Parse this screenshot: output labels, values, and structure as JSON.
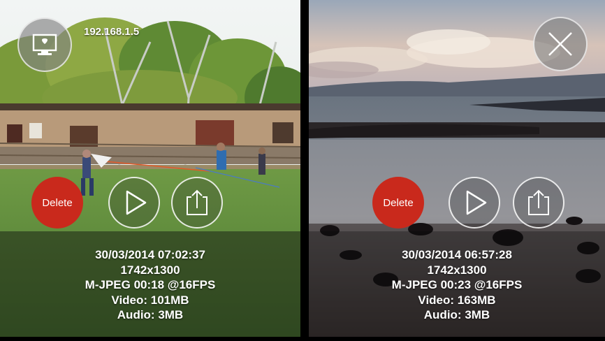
{
  "left_panel": {
    "ip_address": "192.168.1.5",
    "top_button_icon": "monitor-icon",
    "buttons": {
      "delete_label": "Delete",
      "play_icon": "play-icon",
      "share_icon": "share-icon"
    },
    "info": {
      "datetime": "30/03/2014 07:02:37",
      "resolution": "1742x1300",
      "format": "M-JPEG 00:18 @16FPS",
      "video": "Video:  101MB",
      "audio": "Audio:  3MB"
    }
  },
  "right_panel": {
    "top_button_icon": "close-icon",
    "buttons": {
      "delete_label": "Delete",
      "play_icon": "play-icon",
      "share_icon": "share-icon"
    },
    "info": {
      "datetime": "30/03/2014 06:57:28",
      "resolution": "1742x1300",
      "format": "M-JPEG 00:23 @16FPS",
      "video": "Video:  163MB",
      "audio": "Audio:  3MB"
    }
  },
  "colors": {
    "delete_red": "#c9291c"
  }
}
